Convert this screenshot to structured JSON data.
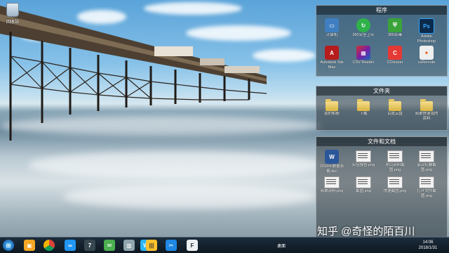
{
  "desktop": {
    "recycle_bin_label": "回收站"
  },
  "fences": {
    "programs": {
      "title": "程序",
      "items": [
        {
          "label": "计算机",
          "icon": "computer-icon"
        },
        {
          "label": "360安全卫士",
          "icon": "360-security-icon"
        },
        {
          "label": "360杀毒",
          "icon": "360-antivirus-icon"
        },
        {
          "label": "Adobe Photoshop",
          "icon": "photoshop-icon",
          "glyph": "Ps"
        },
        {
          "label": "Autodesk 3ds Max",
          "icon": "3dsmax-icon"
        },
        {
          "label": "CSV Reader",
          "icon": "csv-icon"
        },
        {
          "label": "CCleaner",
          "icon": "ccleaner-icon"
        },
        {
          "label": "csRemote",
          "icon": "counter-strike-icon"
        }
      ]
    },
    "folders": {
      "title": "文件夹",
      "items": [
        {
          "label": "我的相册"
        },
        {
          "label": "下载"
        },
        {
          "label": "百度云盘"
        },
        {
          "label": "简单快速我的资料"
        }
      ]
    },
    "documents": {
      "title": "文件和文档",
      "items": [
        {
          "label": "2018年数据表格.doc"
        },
        {
          "label": "实验报告.png"
        },
        {
          "label": "项目资料截图.png"
        },
        {
          "label": "会议纪要截图.png"
        },
        {
          "label": "简单资料.png"
        },
        {
          "label": "截图.png"
        },
        {
          "label": "快速截图.png"
        },
        {
          "label": "打开文件截图.png"
        }
      ]
    }
  },
  "taskbar": {
    "system_label": "桌面",
    "time": "14:06",
    "date": "2018/1/31",
    "app_icons": [
      "start",
      "bookmark",
      "chrome",
      "baidu-netdisk",
      "num7",
      "wechat",
      "folder-blue",
      "word-blue",
      "books",
      "capture",
      "feedly"
    ]
  },
  "watermark": {
    "text": "知乎 @奇怪的陌百川"
  }
}
